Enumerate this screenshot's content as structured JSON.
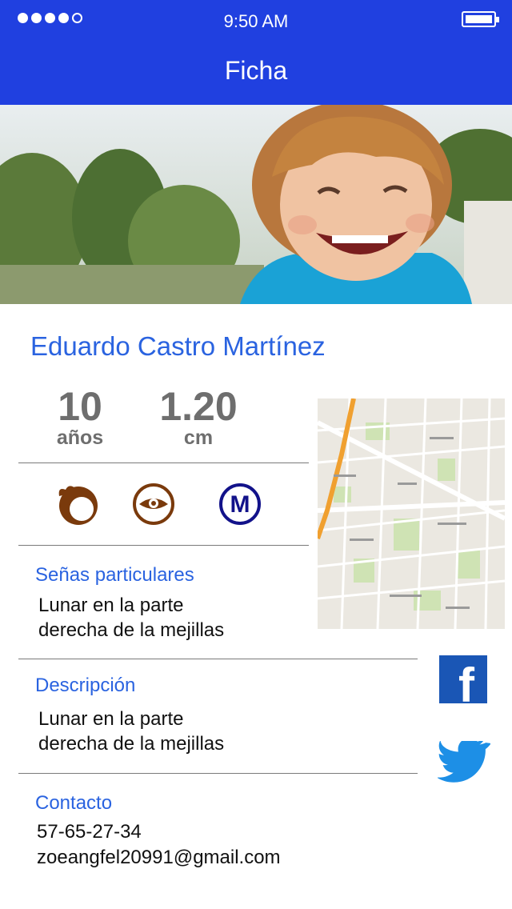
{
  "status_bar": {
    "time": "9:50 AM"
  },
  "header": {
    "title": "Ficha"
  },
  "profile": {
    "name": "Eduardo Castro Martínez",
    "age_value": "10",
    "age_unit": "años",
    "height_value": "1.20",
    "height_unit": "cm"
  },
  "traits": {
    "metro_letter": "M"
  },
  "senas": {
    "title": "Señas particulares",
    "line1": "Lunar en la parte",
    "line2": "derecha de la mejillas"
  },
  "descripcion": {
    "title": "Descripción",
    "line1": "Lunar en la parte",
    "line2": "derecha de la mejillas"
  },
  "contacto": {
    "title": "Contacto",
    "phone": "57-65-27-34",
    "email": "zoeangfel20991@gmail.com"
  },
  "social": {
    "facebook_letter": "f"
  },
  "colors": {
    "header_bg": "#2040e0",
    "accent_text": "#2a63e0",
    "trait_brown": "#7a3a0c",
    "metro_navy": "#12128a",
    "facebook": "#1a56b5",
    "twitter": "#1d8fe6"
  }
}
